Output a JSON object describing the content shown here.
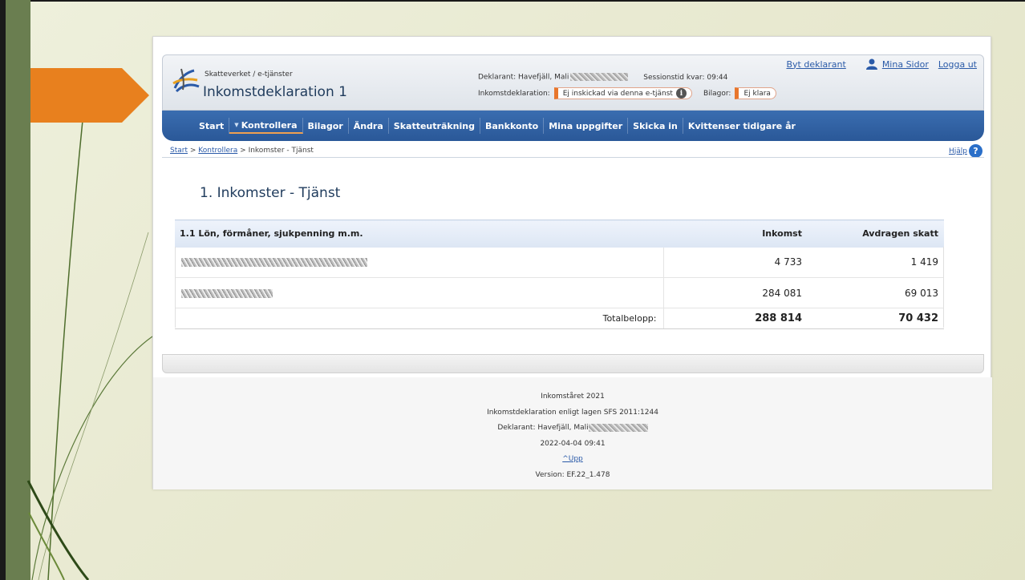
{
  "header": {
    "org": "Skatteverket / e-tjänster",
    "app_title": "Inkomstdeklaration 1",
    "declarant_label": "Deklarant: Havefjäll, Mali",
    "session_label": "Sessionstid kvar: 09:44",
    "declaration_label": "Inkomstdeklaration:",
    "declaration_status": "Ej inskickad via denna e-tjänst",
    "attachments_label": "Bilagor:",
    "attachments_status": "Ej klara",
    "links": {
      "change_declarant": "Byt deklarant",
      "my_pages": "Mina Sidor",
      "logout": "Logga ut"
    },
    "colors": {
      "status_accent": "#e8762c",
      "nav": "#2a5898"
    }
  },
  "nav": {
    "items": [
      {
        "label": "Start"
      },
      {
        "label": "Kontrollera",
        "active": true
      },
      {
        "label": "Bilagor"
      },
      {
        "label": "Ändra"
      },
      {
        "label": "Skatteuträkning"
      },
      {
        "label": "Bankkonto"
      },
      {
        "label": "Mina uppgifter"
      },
      {
        "label": "Skicka in"
      },
      {
        "label": "Kvittenser tidigare år"
      }
    ]
  },
  "breadcrumb": {
    "start": "Start",
    "sep": ">",
    "kontrollera": "Kontrollera",
    "current": "Inkomster - Tjänst"
  },
  "help": {
    "label": "Hjälp",
    "icon": "question-icon"
  },
  "section": {
    "title": "1. Inkomster - Tjänst"
  },
  "table": {
    "headers": {
      "category": "1.1 Lön, förmåner, sjukpenning m.m.",
      "income": "Inkomst",
      "tax": "Avdragen skatt"
    },
    "rows": [
      {
        "income": "4 733",
        "tax": "1 419"
      },
      {
        "income": "284 081",
        "tax": "69 013"
      }
    ],
    "total": {
      "label": "Totalbelopp:",
      "income": "288 814",
      "tax": "70 432"
    }
  },
  "footer": {
    "year": "Inkomståret 2021",
    "law": "Inkomstdeklaration enligt lagen SFS 2011:1244",
    "declarant": "Deklarant: Havefjäll, Mali",
    "datetime": "2022-04-04 09:41",
    "up": "^Upp",
    "version": "Version: EF.22_1.478"
  }
}
